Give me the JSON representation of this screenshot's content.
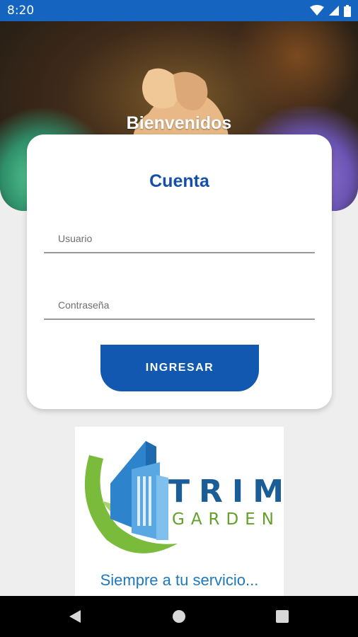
{
  "status_bar": {
    "time": "8:20",
    "background": "#1565c0"
  },
  "hero": {
    "title": "Bienvenidos"
  },
  "login_card": {
    "title": "Cuenta",
    "username_placeholder": "Usuario",
    "password_placeholder": "Contraseña",
    "submit_label": "INGRESAR",
    "accent_color": "#1358b0"
  },
  "logo": {
    "brand_top": "TRIM",
    "brand_bottom": "GARDEN",
    "slogan": "Siempre a tu servicio...",
    "colors": {
      "blue": "#1b5d97",
      "green": "#62a12a"
    }
  },
  "nav_bar": {
    "buttons": [
      "back-icon",
      "home-icon",
      "recents-icon"
    ]
  }
}
